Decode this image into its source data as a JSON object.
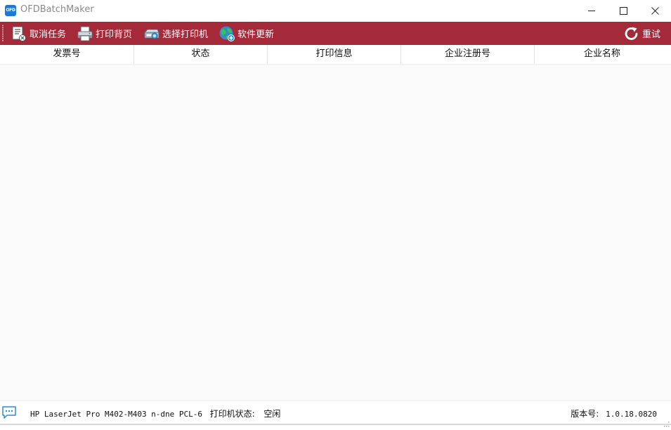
{
  "window": {
    "title": "OFDBatchMaker",
    "icon_text": "OFD"
  },
  "toolbar": {
    "cancel_label": "取消任务",
    "print_back_label": "打印背页",
    "select_printer_label": "选择打印机",
    "update_label": "软件更新",
    "retry_label": "重试"
  },
  "table": {
    "columns": [
      "发票号",
      "状态",
      "打印信息",
      "企业注册号",
      "企业名称"
    ],
    "rows": []
  },
  "statusbar": {
    "printer_name": "HP LaserJet Pro M402-M403 n-dne PCL-6",
    "printer_state_label": "打印机状态:",
    "printer_state": "空闲",
    "version_label": "版本号:",
    "version": "1.0.18.0820"
  },
  "colors": {
    "toolbar_bg": "#a52a39",
    "app_icon": "#1a7ad9"
  },
  "icons": {
    "cancel": "cancel-task-icon",
    "print_back": "printer-icon",
    "select_printer": "scanner-icon",
    "update": "globe-update-icon",
    "retry": "refresh-icon",
    "status": "message-icon"
  }
}
